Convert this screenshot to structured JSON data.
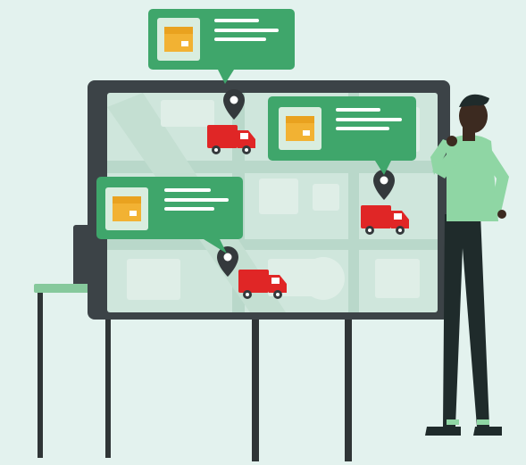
{
  "scene": {
    "description_icons": [
      "package-icon",
      "map-pin-icon",
      "delivery-truck-icon"
    ],
    "colors": {
      "background": "#e3f2ee",
      "board_frame": "#3c4347",
      "map_base": "#cfe6dc",
      "map_road": "#b9d8ca",
      "map_block": "#dfeee7",
      "card_green": "#3fa66b",
      "card_tile": "#d9eddf",
      "package": "#f2b233",
      "truck_red": "#e02626",
      "pin_dark": "#34393c",
      "person_shirt": "#8fd6a4",
      "person_pants": "#1f2b2b",
      "person_skin": "#3c2a20",
      "table_top": "#86c99c",
      "easel_leg": "#2f3536"
    }
  },
  "cards": [
    {
      "id": "card-1",
      "icon": "package-icon"
    },
    {
      "id": "card-2",
      "icon": "package-icon"
    },
    {
      "id": "card-3",
      "icon": "package-icon"
    }
  ],
  "vehicles": [
    {
      "id": "truck-1",
      "icon": "delivery-truck-icon"
    },
    {
      "id": "truck-2",
      "icon": "delivery-truck-icon"
    },
    {
      "id": "truck-3",
      "icon": "delivery-truck-icon"
    }
  ]
}
